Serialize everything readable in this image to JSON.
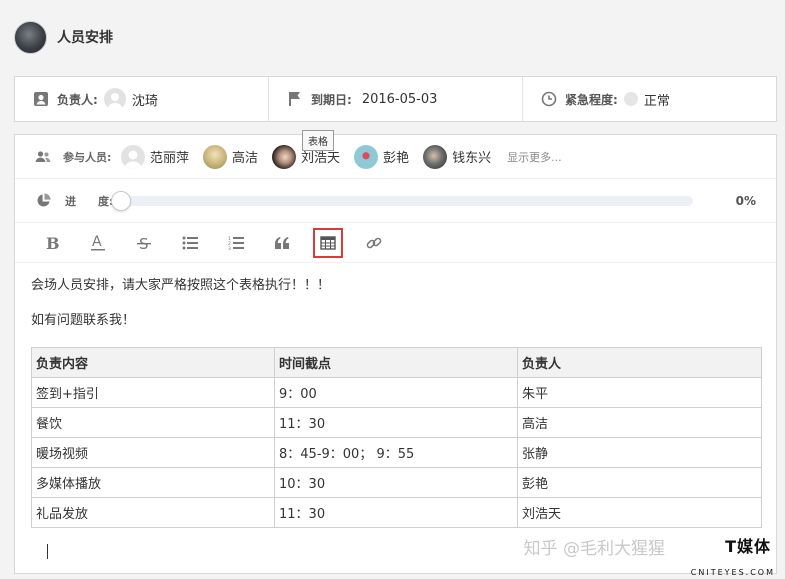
{
  "header": {
    "title": "人员安排"
  },
  "meta": {
    "owner_label": "负责人:",
    "owner_name": "沈琦",
    "due_label": "到期日:",
    "due_date": "2016-05-03",
    "urgency_label": "紧急程度:",
    "urgency_value": "正常"
  },
  "participants": {
    "label": "参与人员:",
    "people": [
      {
        "name": "范丽萍",
        "avatar_color": "#e2e2e2"
      },
      {
        "name": "高洁",
        "avatar_color": "#c9b27a"
      },
      {
        "name": "刘浩天",
        "avatar_color": "#5a4a44"
      },
      {
        "name": "彭艳",
        "avatar_color": "#8fc9d8"
      },
      {
        "name": "钱东兴",
        "avatar_color": "#6e6e6e"
      }
    ],
    "show_more": "显示更多..."
  },
  "progress": {
    "label_a": "进",
    "label_b": "度:",
    "value_percent": 0,
    "text": "0%"
  },
  "toolbar": {
    "buttons": [
      "bold-icon",
      "underline-icon",
      "strikethrough-icon",
      "bullet-list-icon",
      "numbered-list-icon",
      "quote-icon",
      "table-icon",
      "link-icon"
    ],
    "active": "table-icon",
    "tooltip": "表格"
  },
  "content": {
    "line1": "会场人员安排，请大家严格按照这个表格执行！！！",
    "line2": "如有问题联系我！",
    "table": {
      "headers": [
        "负责内容",
        "时间截点",
        "负责人"
      ],
      "rows": [
        [
          "签到+指引",
          "9：00",
          "朱平"
        ],
        [
          "餐饮",
          "11：30",
          "高洁"
        ],
        [
          "暖场视频",
          "8：45-9：00； 9：55",
          "张静"
        ],
        [
          "多媒体播放",
          "10：30",
          "彭艳"
        ],
        [
          "礼品发放",
          "11：30",
          "刘浩天"
        ]
      ]
    }
  },
  "watermark": {
    "text": "知乎 @毛利大猩猩",
    "logo": "T媒体",
    "logo_sub": "CNITEYES.COM"
  },
  "colors": {
    "highlight": "#d83b3b",
    "progress": "#6c8ee0"
  }
}
